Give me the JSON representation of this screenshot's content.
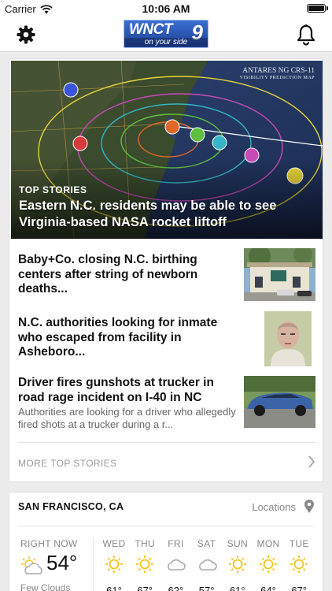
{
  "status_bar": {
    "carrier": "Carrier",
    "time": "10:06 AM"
  },
  "nav": {
    "logo_main": "WNCT",
    "logo_number": "9",
    "logo_tagline": "on your side"
  },
  "hero": {
    "kicker": "TOP STORIES",
    "headline": "Eastern N.C. residents may be able to see Virginia-based NASA rocket liftoff",
    "map_title": "ANTARES NG CRS-11",
    "map_subtitle": "VISIBILITY PREDICTION MAP"
  },
  "stories": [
    {
      "title": "Baby+Co. closing N.C. birthing centers after string of newborn deaths...",
      "summary": ""
    },
    {
      "title": "N.C. authorities looking for inmate who escaped from facility in Asheboro...",
      "summary": ""
    },
    {
      "title": "Driver fires gunshots at trucker in road rage incident on I-40 in NC",
      "summary": "Authorities are looking for a driver who allegedly fired shots at a trucker during a r..."
    }
  ],
  "more_link": "MORE TOP STORIES",
  "weather": {
    "city": "SAN FRANCISCO, CA",
    "locations_label": "Locations",
    "now": {
      "label": "RIGHT NOW",
      "temp": "54°",
      "condition": "Few Clouds",
      "icon": "partly-cloudy-icon"
    },
    "forecast": [
      {
        "day": "WED",
        "icon": "sun-icon",
        "hi": "61°"
      },
      {
        "day": "THU",
        "icon": "sun-icon",
        "hi": "67°"
      },
      {
        "day": "FRI",
        "icon": "cloud-icon",
        "hi": "62°"
      },
      {
        "day": "SAT",
        "icon": "cloud-icon",
        "hi": "57°"
      },
      {
        "day": "SUN",
        "icon": "sun-icon",
        "hi": "61°"
      },
      {
        "day": "MON",
        "icon": "sun-icon",
        "hi": "64°"
      },
      {
        "day": "TUE",
        "icon": "sun-icon",
        "hi": "67°"
      }
    ]
  },
  "colors": {
    "accent": "#1d3f95",
    "sun": "#f5c518",
    "muted": "#888888"
  }
}
